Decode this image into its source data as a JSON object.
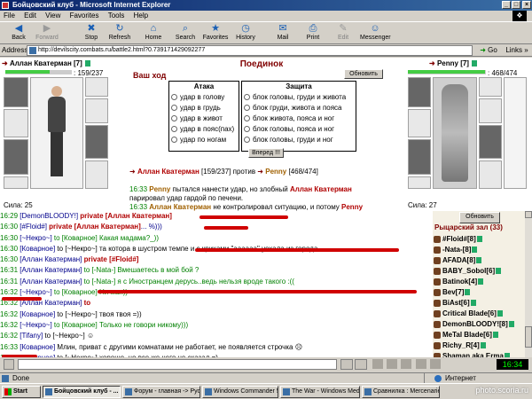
{
  "window": {
    "title": "Бойцовский клуб - Microsoft Internet Explorer"
  },
  "menu": [
    "File",
    "Edit",
    "View",
    "Favorites",
    "Tools",
    "Help"
  ],
  "toolbar": [
    {
      "label": "Back",
      "icon": "back-arrow-icon",
      "glyph": "◀",
      "enabled": true
    },
    {
      "label": "Forward",
      "icon": "forward-arrow-icon",
      "glyph": "▶",
      "enabled": false
    },
    {
      "label": "Stop",
      "icon": "stop-icon",
      "glyph": "✖",
      "enabled": true
    },
    {
      "label": "Refresh",
      "icon": "refresh-icon",
      "glyph": "↻",
      "enabled": true
    },
    {
      "label": "Home",
      "icon": "home-icon",
      "glyph": "⌂",
      "enabled": true
    },
    {
      "label": "Search",
      "icon": "search-icon",
      "glyph": "⌕",
      "enabled": true
    },
    {
      "label": "Favorites",
      "icon": "star-icon",
      "glyph": "★",
      "enabled": true
    },
    {
      "label": "History",
      "icon": "history-icon",
      "glyph": "◷",
      "enabled": true
    },
    {
      "label": "Mail",
      "icon": "mail-icon",
      "glyph": "✉",
      "enabled": true
    },
    {
      "label": "Print",
      "icon": "printer-icon",
      "glyph": "⎙",
      "enabled": true
    },
    {
      "label": "Edit",
      "icon": "edit-icon",
      "glyph": "✎",
      "enabled": false
    },
    {
      "label": "Messenger",
      "icon": "messenger-icon",
      "glyph": "☺",
      "enabled": true
    }
  ],
  "address": {
    "label": "Address",
    "url": "http://devilscity.combats.ru/battle2.html?0.739171429092277",
    "go": "Go",
    "links": "Links"
  },
  "battle": {
    "player_left": {
      "name": "Аллан Кватерман",
      "level": "[7]",
      "hp": "159/237",
      "hp_ratio": 0.67,
      "strength": "Сила: 25"
    },
    "player_right": {
      "name": "Penny",
      "level": "[7]",
      "hp": "468/474",
      "hp_ratio": 0.99,
      "strength": "Сила: 27"
    },
    "title": "Поединок",
    "your_turn": "Ваш ход",
    "refresh_btn": "Обновить",
    "attack_header": "Атака",
    "defense_header": "Защита",
    "attacks": [
      "удар в голову",
      "удар в грудь",
      "удар в живот",
      "удар в пояс(пах)",
      "удар по ногам"
    ],
    "defenses": [
      "блок головы, груди и живота",
      "блок груди, живота и пояса",
      "блок живота, пояса и ног",
      "блок головы, пояса и ног",
      "блок головы, груди и ног"
    ],
    "submit": "Вперед !!!",
    "versus": {
      "left": "Аллан Кватерман",
      "left_hp": "[159/237]",
      "word": "против",
      "right": "Penny",
      "right_hp": "[468/474]"
    },
    "log": [
      {
        "time": "16:33",
        "a": "Penny",
        "text1": " пытался нанести удар, но злобный ",
        "b": "Аллан Кватерман",
        "text2": ""
      },
      {
        "time": "",
        "a": "",
        "text1": "парировал удар гардой по печени.",
        "b": "",
        "text2": ""
      },
      {
        "time": "16:33",
        "a": "Аллан Кватерман",
        "text1": " не контролировал ситуацию, и потому ",
        "b": "Penny",
        "text2": ""
      }
    ]
  },
  "chat": [
    {
      "time": "16:29",
      "parts": [
        [
          "blue",
          "[DemonBLOODY!] "
        ],
        [
          "red",
          "private [Аллан Кватерман]"
        ]
      ]
    },
    {
      "time": "16:30",
      "parts": [
        [
          "blue",
          "[#Floid#] "
        ],
        [
          "red",
          "private [Аллан Кватерман]"
        ],
        [
          "blue",
          "... %)))"
        ]
      ]
    },
    {
      "time": "16:30",
      "parts": [
        [
          "blue",
          "[~Некро~] "
        ],
        [
          "grn",
          "to [Коварное] Какая мадама?_))"
        ]
      ]
    },
    {
      "time": "16:30",
      "parts": [
        [
          "blue",
          "[Коварное] "
        ],
        [
          "",
          "to [~Некро~] та котора в шустром темпе и с криками \"аааааа\" уехала из города"
        ]
      ]
    },
    {
      "time": "16:30",
      "parts": [
        [
          "blue",
          "[Аллан Кватерман] "
        ],
        [
          "red",
          "private [#Floid#]"
        ]
      ]
    },
    {
      "time": "16:31",
      "parts": [
        [
          "blue",
          "[Аллан Кватерман] "
        ],
        [
          "grn",
          "to [-Nata-] Вмешаетесь в мой бой ?"
        ]
      ]
    },
    {
      "time": "16:31",
      "parts": [
        [
          "blue",
          "[Аллан Кватерман] "
        ],
        [
          "grn",
          "to [-Nata-] я с Иностранцем дерусь..ведь нельзя вроде такого :(("
        ]
      ]
    },
    {
      "time": "16:32",
      "parts": [
        [
          "blue",
          "[~Некро~] "
        ],
        [
          "grn",
          "to [Коварное] Ни мая))"
        ]
      ]
    },
    {
      "time": "16:32",
      "parts": [
        [
          "blue",
          "[Аллан Кватерман] "
        ],
        [
          "red",
          "to"
        ]
      ]
    },
    {
      "time": "16:32",
      "parts": [
        [
          "blue",
          "[Коварное] "
        ],
        [
          "",
          "to [~Некро~] твоя твоя =))"
        ]
      ]
    },
    {
      "time": "16:32",
      "parts": [
        [
          "blue",
          "[~Некро~] "
        ],
        [
          "grn",
          "to [Коварное] Только не говори никому)))"
        ]
      ]
    },
    {
      "time": "16:32",
      "parts": [
        [
          "blue",
          "[Tifany] "
        ],
        [
          "",
          "to [~Некро~] ☺"
        ]
      ]
    },
    {
      "time": "16:33",
      "parts": [
        [
          "blue",
          "[Коварное] "
        ],
        [
          "",
          "Млин, приват с другими комнатами не работает, не появляется строчка ☹"
        ]
      ]
    },
    {
      "time": "16:33",
      "parts": [
        [
          "blue",
          "[Коварное] "
        ],
        [
          "",
          "to [~Некро~] хорошо, но все же чего не сказал =)"
        ]
      ]
    }
  ],
  "side": {
    "refresh": "Обновить",
    "room": "Рыцарский зал (33)",
    "users": [
      "#Floid#[8]",
      "-Nata-[8]",
      "AFADA[8]",
      "BABY_Sobol[6]",
      "Batinok[4]",
      "Bev[7]",
      "BiAst[6]",
      "Critical Blade[6]",
      "DemonBLOODY![8]",
      "MeTal Blade[6]",
      "Richy_R[4]",
      "Shaman aka Erma"
    ]
  },
  "clock": "16:34",
  "status": {
    "text": "Done",
    "zone": "Интернет"
  },
  "taskbar": {
    "start": "Start",
    "tasks": [
      "Бойцовский клуб - ...",
      "Форум - главная -> Русс...",
      "Windows Commander 5.0",
      "The War - Windows Media...",
      "Сравнилка : Mercenaries ..."
    ]
  },
  "watermark": "photo.scoria.ru",
  "colors": {
    "hp_green": "#44cc44",
    "player_red": "#b00000",
    "chat_time": "#008000",
    "title_bar": "#0a246a"
  }
}
